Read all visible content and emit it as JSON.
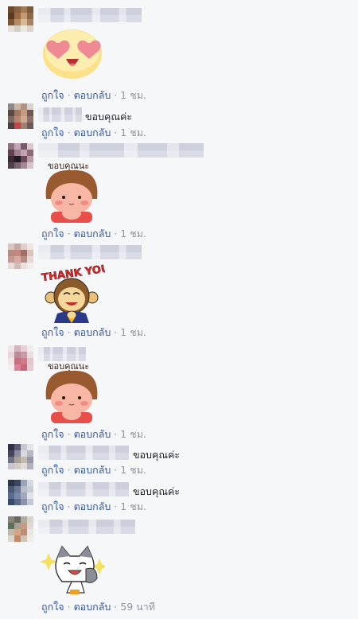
{
  "actions": {
    "like": "ถูกใจ",
    "reply": "ตอบกลับ",
    "separator": "·"
  },
  "comments": [
    {
      "text": "",
      "sticker": "heart-eyes-emoji-sticker",
      "time": "1 ชม."
    },
    {
      "text": "ขอบคุณค่ะ",
      "time": "1 ชม."
    },
    {
      "text": "",
      "sticker": "girl-thank-you-sticker",
      "sticker_text": "ขอบคุณนะ",
      "time": "1 ชม."
    },
    {
      "text": "",
      "sticker": "monkey-thank-you-sticker",
      "sticker_text": "THANK YOU",
      "time": "1 ชม."
    },
    {
      "text": "",
      "sticker": "girl-thank-you-sticker",
      "sticker_text": "ขอบคุณนะ",
      "time": "1 ชม."
    },
    {
      "text": "ขอบคุณค่ะ",
      "time": "1 ชม."
    },
    {
      "text": "ขอบคุณค่ะ",
      "time": "1 ชม."
    },
    {
      "text": "",
      "sticker": "cat-thumbs-up-sticker",
      "time": "59 นาที"
    }
  ],
  "colors": {
    "link": "#385898",
    "meta": "#90949c",
    "background": "#f6f7f9"
  }
}
